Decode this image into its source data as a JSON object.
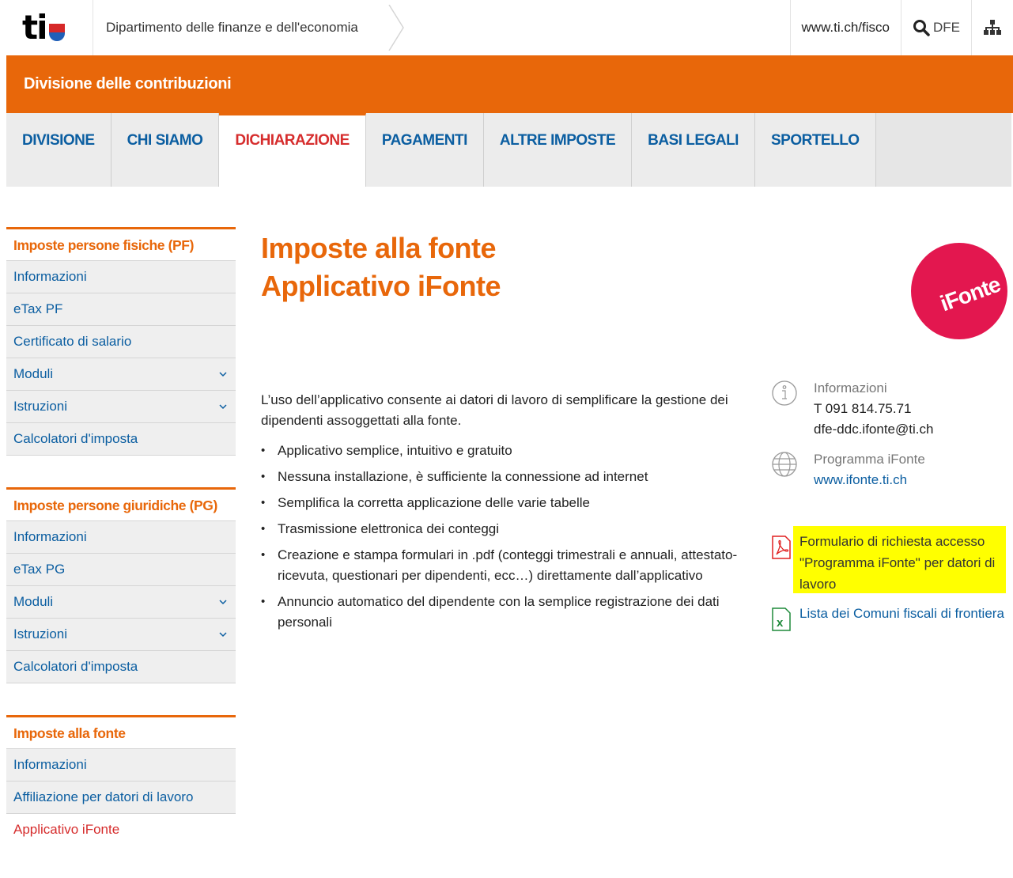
{
  "header": {
    "logo": "ti",
    "department": "Dipartimento delle finanze e dell'economia",
    "fisco_link": "www.ti.ch/fisco",
    "search_label": "DFE"
  },
  "band": {
    "title": "Divisione delle contribuzioni"
  },
  "nav": {
    "tabs": [
      {
        "label": "DIVISIONE"
      },
      {
        "label": "CHI SIAMO"
      },
      {
        "label": "DICHIARAZIONE"
      },
      {
        "label": "PAGAMENTI"
      },
      {
        "label": "ALTRE IMPOSTE"
      },
      {
        "label": "BASI LEGALI"
      },
      {
        "label": "SPORTELLO"
      }
    ]
  },
  "sidebar": {
    "groups": [
      {
        "title": "Imposte persone fisiche (PF)",
        "items": [
          "Informazioni",
          "eTax PF",
          "Certificato di salario",
          "Moduli",
          "Istruzioni",
          "Calcolatori d'imposta"
        ]
      },
      {
        "title": "Imposte persone giuridiche (PG)",
        "items": [
          "Informazioni",
          "eTax PG",
          "Moduli",
          "Istruzioni",
          "Calcolatori d'imposta"
        ]
      },
      {
        "title": "Imposte alla fonte",
        "items": [
          "Informazioni",
          "Affiliazione per datori di lavoro",
          "Applicativo iFonte"
        ]
      }
    ]
  },
  "main": {
    "title_line1": "Imposte alla fonte",
    "title_line2": "Applicativo iFonte",
    "intro": "L’uso dell’applicativo consente ai datori di lavoro di semplificare la gestione dei dipendenti assoggettati alla fonte.",
    "bullets": [
      "Applicativo semplice, intuitivo e gratuito",
      "Nessuna installazione, è sufficiente la connessione ad internet",
      "Semplifica la corretta applicazione delle varie tabelle",
      "Trasmissione elettronica dei conteggi",
      "Creazione e stampa formulari in .pdf (conteggi trimestrali e annuali, attestato-ricevuta, questionari per dipendenti, ecc…) direttamente dall’applicativo",
      "Annuncio automatico del dipendente con la semplice registrazione dei dati personali"
    ]
  },
  "badge": {
    "text": "iFonte"
  },
  "info": {
    "contact_label": "Informazioni",
    "phone": "T 091 814.75.71",
    "email": "dfe-ddc.ifonte@ti.ch",
    "program_label": "Programma iFonte",
    "program_link": "www.ifonte.ti.ch"
  },
  "downloads": {
    "form": "Formulario di richiesta accesso \"Programma iFonte\" per datori di lavoro",
    "list": "Lista dei Comuni fiscali di frontiera"
  },
  "colors": {
    "accent": "#e8670a",
    "link": "#0b5ea1",
    "active": "#d62d2d",
    "badge": "#e3174f",
    "highlight": "#ffff00"
  }
}
